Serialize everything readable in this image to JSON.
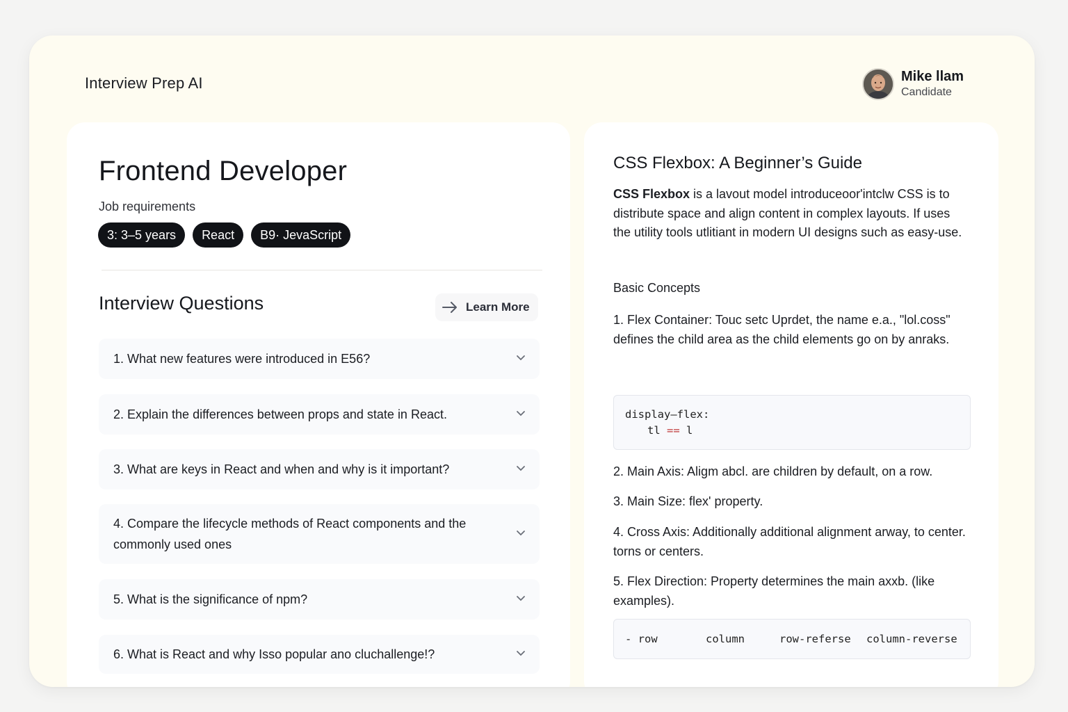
{
  "app": {
    "brand": "Interview Prep AI",
    "user": {
      "name": "Mike llam",
      "role": "Candidate"
    }
  },
  "job": {
    "title": "Frontend Developer",
    "requirements_label": "Job requirements",
    "chips": [
      "3: 3–5 years",
      "React",
      "B9· JevaScript"
    ]
  },
  "questions": {
    "heading": "Interview Questions",
    "learn_more": "Learn More",
    "items": [
      "1. What new features were introduced in E56?",
      "2. Explain the differences between props and state in React.",
      "3. What are keys in React and when and why is it important?",
      "4. Compare the lifecycle methods of React components and the commonly used ones",
      "5. What is the significance of npm?",
      "6. What is React and why Isso popular ano  cluchallenge!?"
    ]
  },
  "guide": {
    "title": "CSS Flexbox: A Beginner’s Guide",
    "intro_strong": "CSS Flexbox",
    "intro_rest": " is a lavout model introduceoor'intclw CSS is to distribute space and align content in complex layouts. If uses the utility tools utlitiant in modern UI designs such as easy-use.",
    "basic_heading": "Basic Concepts",
    "item1_label": "1. Flex Container:",
    "item1_text": " Touс setc Uprdet, the name e.a., \"lol.coss\" defines the child area as the child elements go on by anraks.",
    "code1_line1": "display–flex:",
    "code1_line2_a": "tl ",
    "code1_line2_b": "==",
    "code1_line2_c": " l",
    "item2_label": "2. Main Axis:",
    "item2_text": " Aligm abcl. are children by default, on a row.",
    "item3_label": "3. Main Size:",
    "item3_text": " flex' property.",
    "item4_label": "4. Cross Axis:",
    "item4_text": " Additionally additional alignment arway, to center. torns or centers.",
    "item5_label": "5. Flex Direction:",
    "item5_text": " Property determines the main axxb. (like examples).",
    "code2": [
      "- row",
      "column",
      "row-referse",
      "column-reverse"
    ]
  }
}
